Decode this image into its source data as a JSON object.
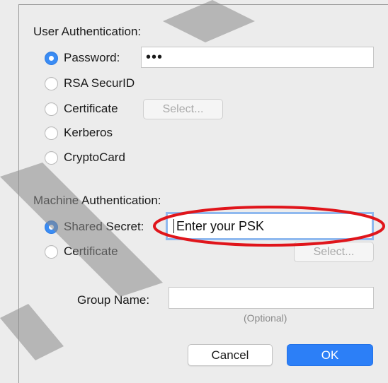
{
  "user_auth": {
    "title": "User Authentication:",
    "options": [
      {
        "label": "Password:",
        "checked": true
      },
      {
        "label": "RSA SecurID",
        "checked": false
      },
      {
        "label": "Certificate",
        "checked": false
      },
      {
        "label": "Kerberos",
        "checked": false
      },
      {
        "label": "CryptoCard",
        "checked": false
      }
    ],
    "password_value": "•••",
    "select_button": "Select..."
  },
  "machine_auth": {
    "title": "Machine Authentication:",
    "options": [
      {
        "label": "Shared Secret:",
        "checked": true
      },
      {
        "label": "Certificate",
        "checked": false
      }
    ],
    "shared_secret_value": "Enter your PSK",
    "select_button": "Select..."
  },
  "group": {
    "label": "Group Name:",
    "value": "",
    "hint": "(Optional)"
  },
  "buttons": {
    "cancel": "Cancel",
    "ok": "OK"
  },
  "colors": {
    "accent": "#2c7ff7",
    "annotation": "#e0151b",
    "watermark": "#8a8a8a"
  }
}
